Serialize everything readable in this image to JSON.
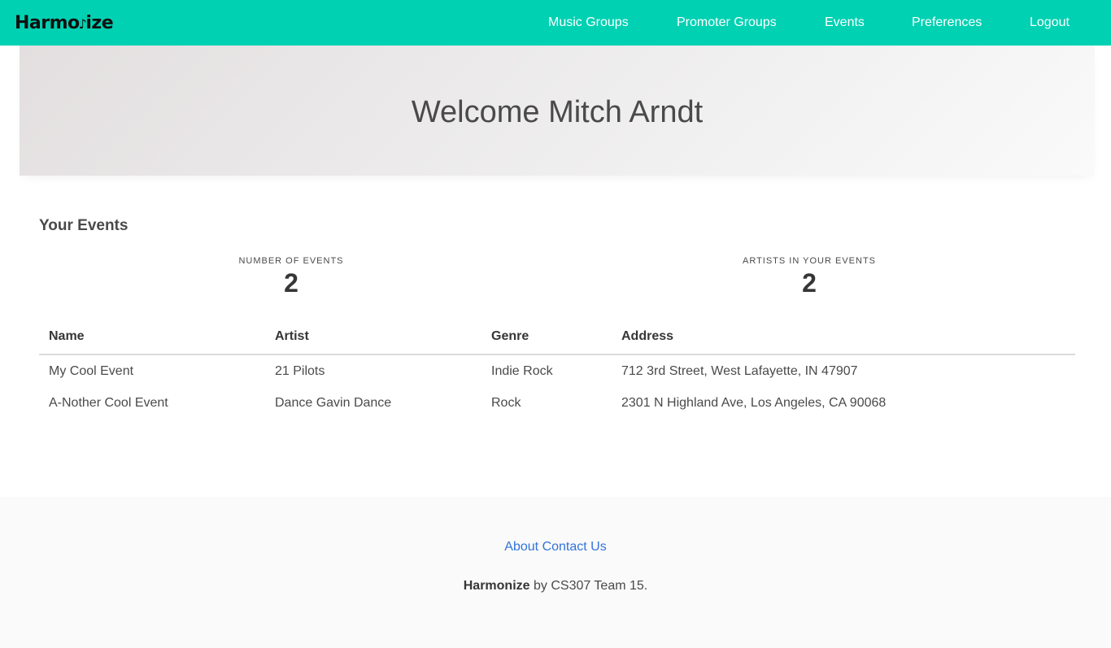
{
  "brand": {
    "name_start": "Harmo",
    "name_note": "♪",
    "name_end": "ize"
  },
  "nav": {
    "items": [
      "Music Groups",
      "Promoter Groups",
      "Events",
      "Preferences",
      "Logout"
    ]
  },
  "hero": {
    "title": "Welcome Mitch Arndt"
  },
  "events_section": {
    "title": "Your Events",
    "stats": [
      {
        "heading": "NUMBER OF EVENTS",
        "value": "2"
      },
      {
        "heading": "ARTISTS IN YOUR EVENTS",
        "value": "2"
      }
    ],
    "table": {
      "columns": [
        "Name",
        "Artist",
        "Genre",
        "Address"
      ],
      "rows": [
        [
          "My Cool Event",
          "21 Pilots",
          "Indie Rock",
          "712 3rd Street, West Lafayette, IN 47907"
        ],
        [
          "A-Nother Cool Event",
          "Dance Gavin Dance",
          "Rock",
          "2301 N Highland Ave, Los Angeles, CA 90068"
        ]
      ]
    }
  },
  "footer": {
    "about_label": "About",
    "contact_label": "Contact Us",
    "credit_brand": "Harmonize",
    "credit_text": " by CS307 Team 15."
  },
  "colors": {
    "navbar": "#00d1b2",
    "link": "#3273dc",
    "footer_bg": "#fafafa"
  }
}
